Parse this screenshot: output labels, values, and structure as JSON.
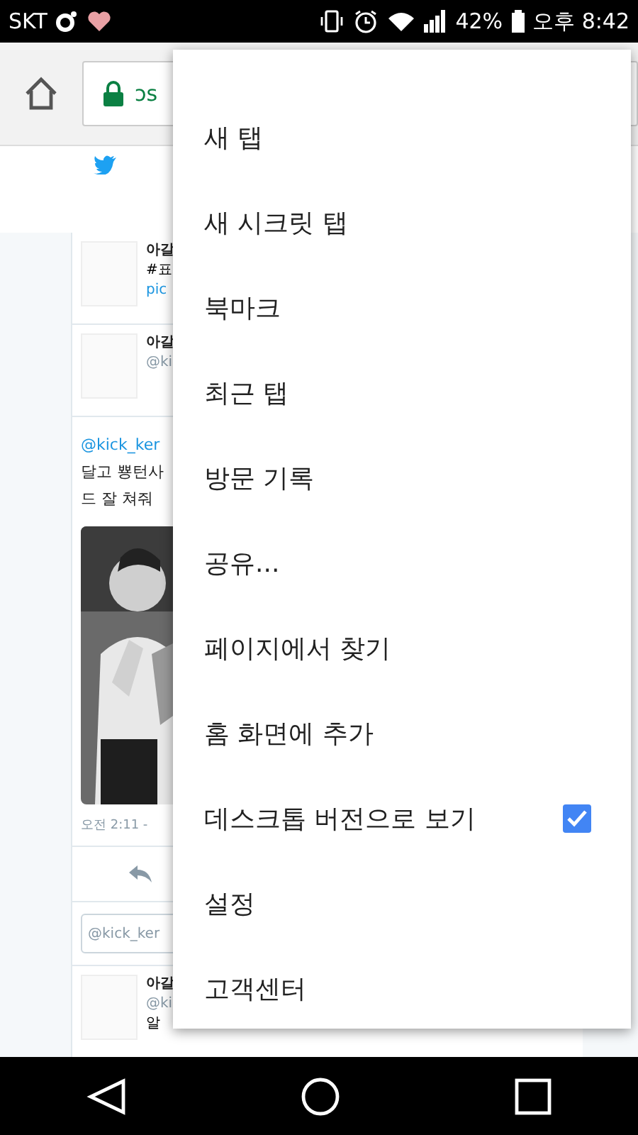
{
  "status_bar": {
    "carrier": "SKT",
    "battery": "42%",
    "time": "오후 8:42"
  },
  "toolbar": {
    "url": "ɔs"
  },
  "page": {
    "tweets": [
      {
        "author": "아갈",
        "lines": [
          "#표"
        ],
        "link": "pic"
      },
      {
        "author": "아갈",
        "handle": "@ki"
      }
    ],
    "reply_text": {
      "mention": "@kick_ker",
      "lines": [
        "달고 뿅턴사",
        "드 잘 쳐줘"
      ]
    },
    "timestamp": "오전 2:11 -",
    "reply_box": {
      "placeholder": "@kick_ker"
    },
    "last_tweet": {
      "author": "아갈",
      "handle": "@ki",
      "line": "알"
    }
  },
  "menu": {
    "items": [
      {
        "kind": "plain",
        "label": "새 탭"
      },
      {
        "kind": "plain",
        "label": "새 시크릿 탭"
      },
      {
        "kind": "plain",
        "label": "북마크"
      },
      {
        "kind": "plain",
        "label": "최근 탭"
      },
      {
        "kind": "plain",
        "label": "방문 기록"
      },
      {
        "kind": "plain",
        "label": "공유..."
      },
      {
        "kind": "plain",
        "label": "페이지에서 찾기"
      },
      {
        "kind": "plain",
        "label": "홈 화면에 추가"
      },
      {
        "kind": "checkbox",
        "label": "데스크톱 버전으로 보기",
        "checked": true
      },
      {
        "kind": "plain",
        "label": "설정"
      },
      {
        "kind": "plain",
        "label": "고객센터"
      }
    ]
  }
}
